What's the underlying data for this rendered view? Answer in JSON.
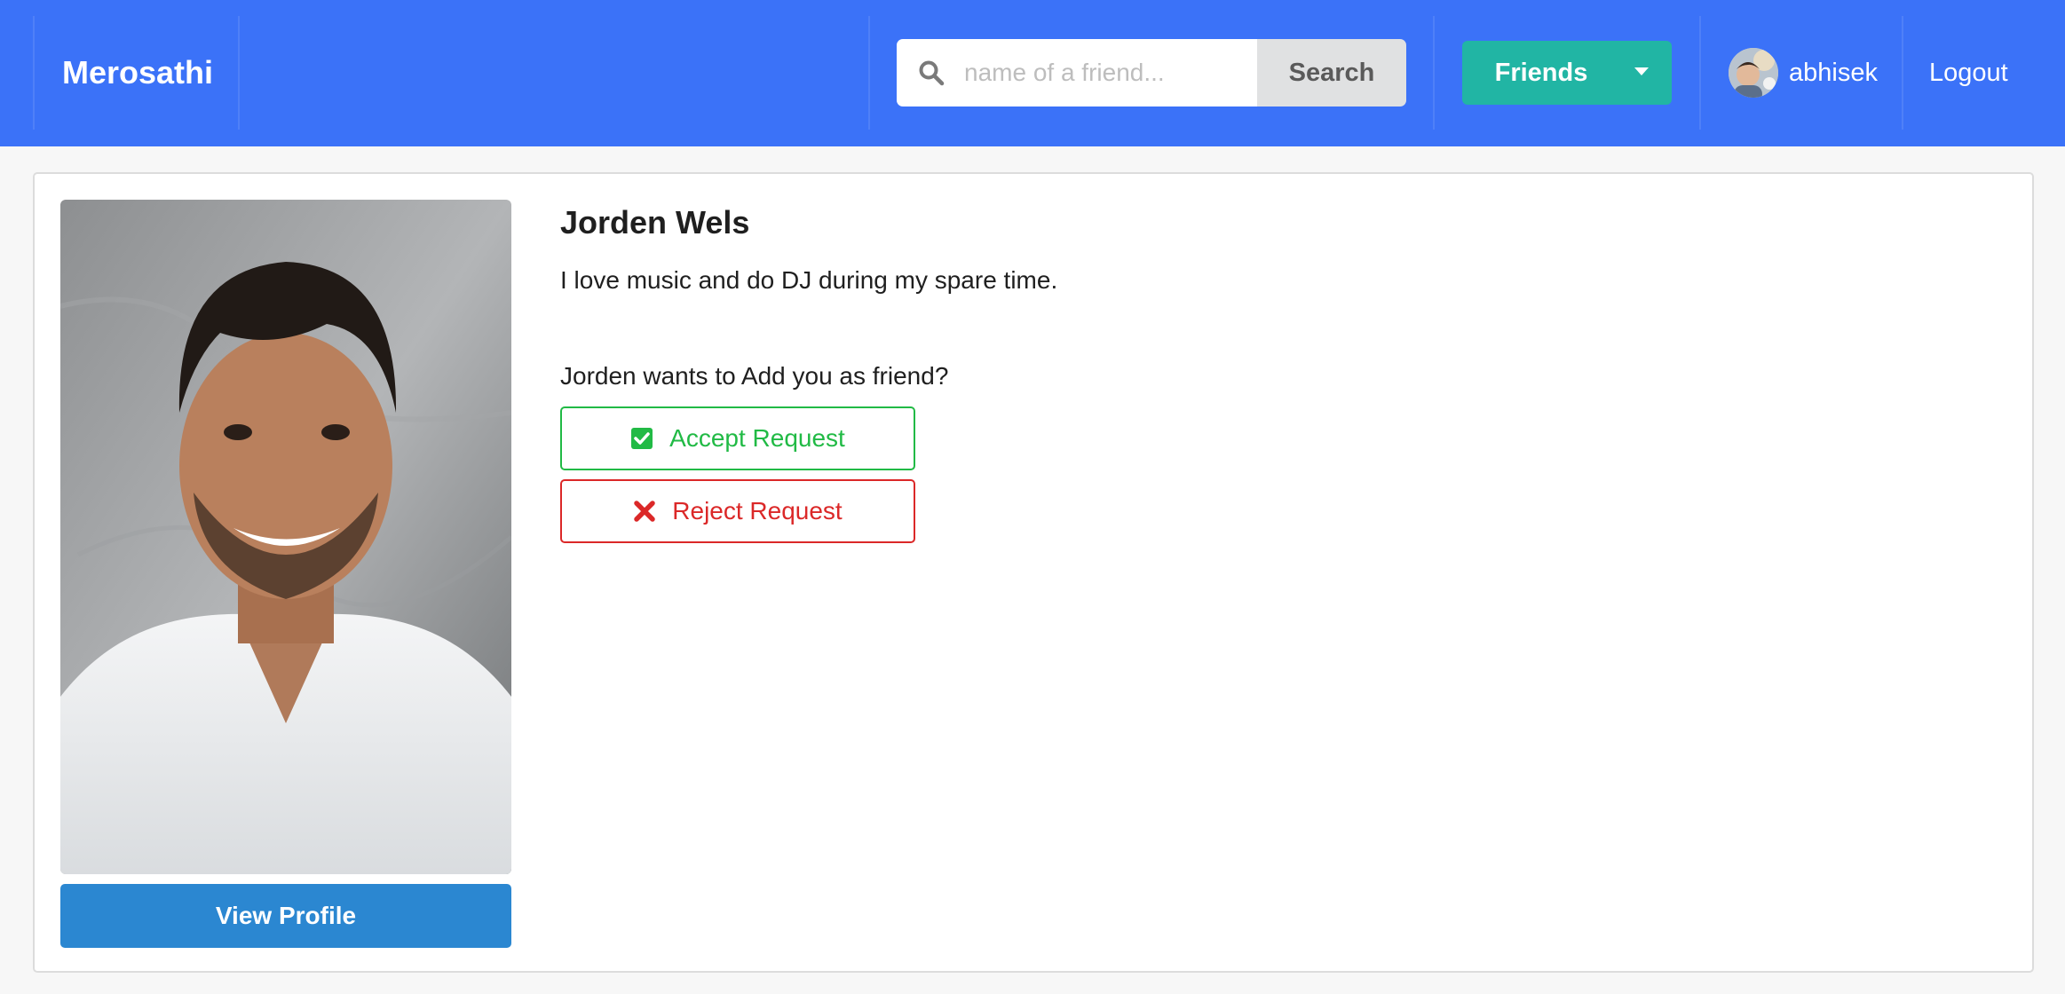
{
  "navbar": {
    "brand": "Merosathi",
    "search": {
      "placeholder": "name of a friend...",
      "value": "",
      "button_label": "Search",
      "icon": "search-icon"
    },
    "friends_button": {
      "label": "Friends",
      "icon": "caret-down-icon"
    },
    "user": {
      "name": "abhisek",
      "avatar": "avatar"
    },
    "logout_label": "Logout"
  },
  "profile": {
    "name": "Jorden Wels",
    "bio": "I love music and do DJ during my spare time.",
    "view_profile_label": "View Profile",
    "request_prompt": "Jorden wants to Add you as friend?",
    "accept_label": "Accept Request",
    "reject_label": "Reject Request"
  },
  "colors": {
    "navbar": "#3b72f8",
    "friends_button": "#21b5a4",
    "view_profile_button": "#2b87d1",
    "accept": "#21ba45",
    "reject": "#db2828"
  }
}
